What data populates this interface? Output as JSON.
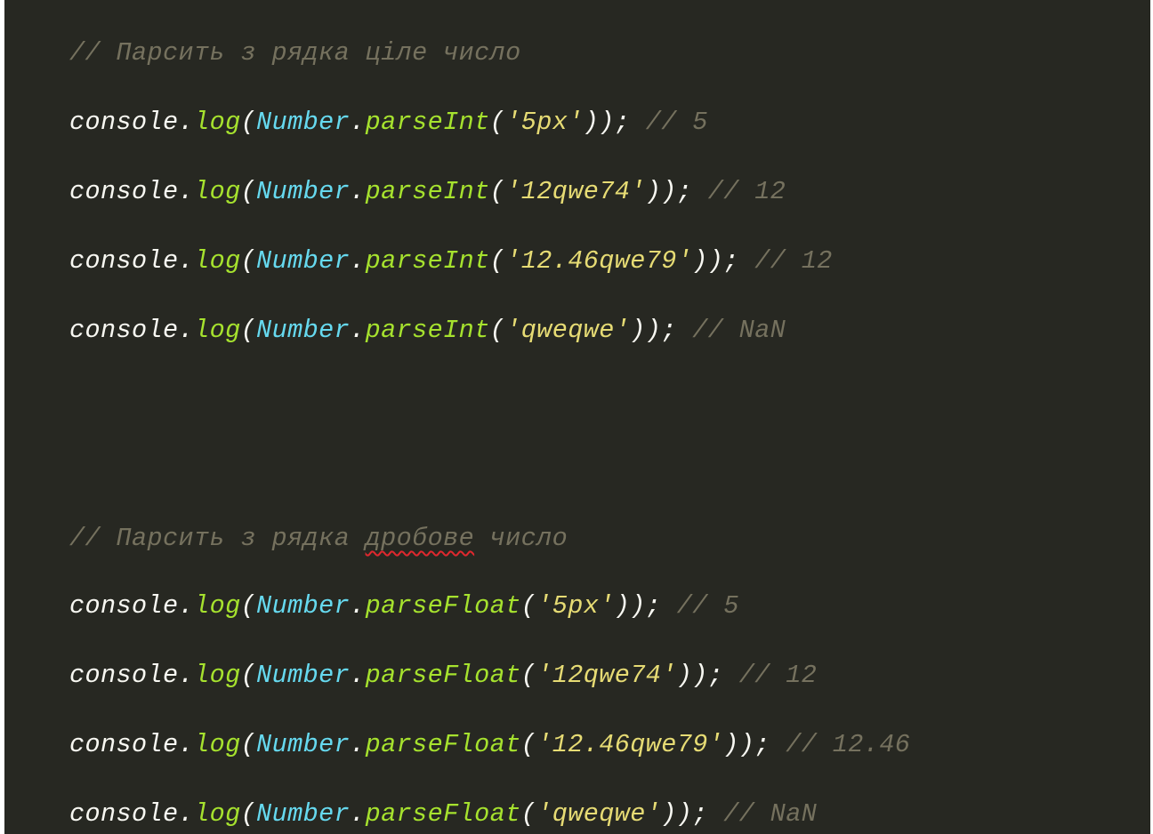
{
  "colors": {
    "background": "#272822",
    "comment": "#75715e",
    "identifier": "#f8f8f2",
    "function": "#a6e22e",
    "class": "#66d9ef",
    "string": "#e6db74",
    "spell_error": "#e0282e"
  },
  "tokens": {
    "console": "console",
    "dot": ".",
    "log": "log",
    "open_paren": "(",
    "number": "Number",
    "parse_int": "parseInt",
    "parse_float": "parseFloat",
    "close_end": "));",
    "space": " ",
    "comment_prefix": "// "
  },
  "blocks": [
    {
      "comment": {
        "before": "// Парсить з рядка ціле число",
        "flagged_word": "",
        "after": ""
      },
      "lines": [
        {
          "arg": "'5px'",
          "result": "5"
        },
        {
          "arg": "'12qwe74'",
          "result": "12"
        },
        {
          "arg": "'12.46qwe79'",
          "result": "12"
        },
        {
          "arg": "'qweqwe'",
          "result": "NaN"
        }
      ]
    },
    {
      "comment": {
        "before": "// Парсить з рядка ",
        "flagged_word": "дробове",
        "after": " число"
      },
      "lines": [
        {
          "arg": "'5px'",
          "result": "5"
        },
        {
          "arg": "'12qwe74'",
          "result": "12"
        },
        {
          "arg": "'12.46qwe79'",
          "result": "12.46"
        },
        {
          "arg": "'qweqwe'",
          "result": "NaN"
        }
      ]
    }
  ]
}
